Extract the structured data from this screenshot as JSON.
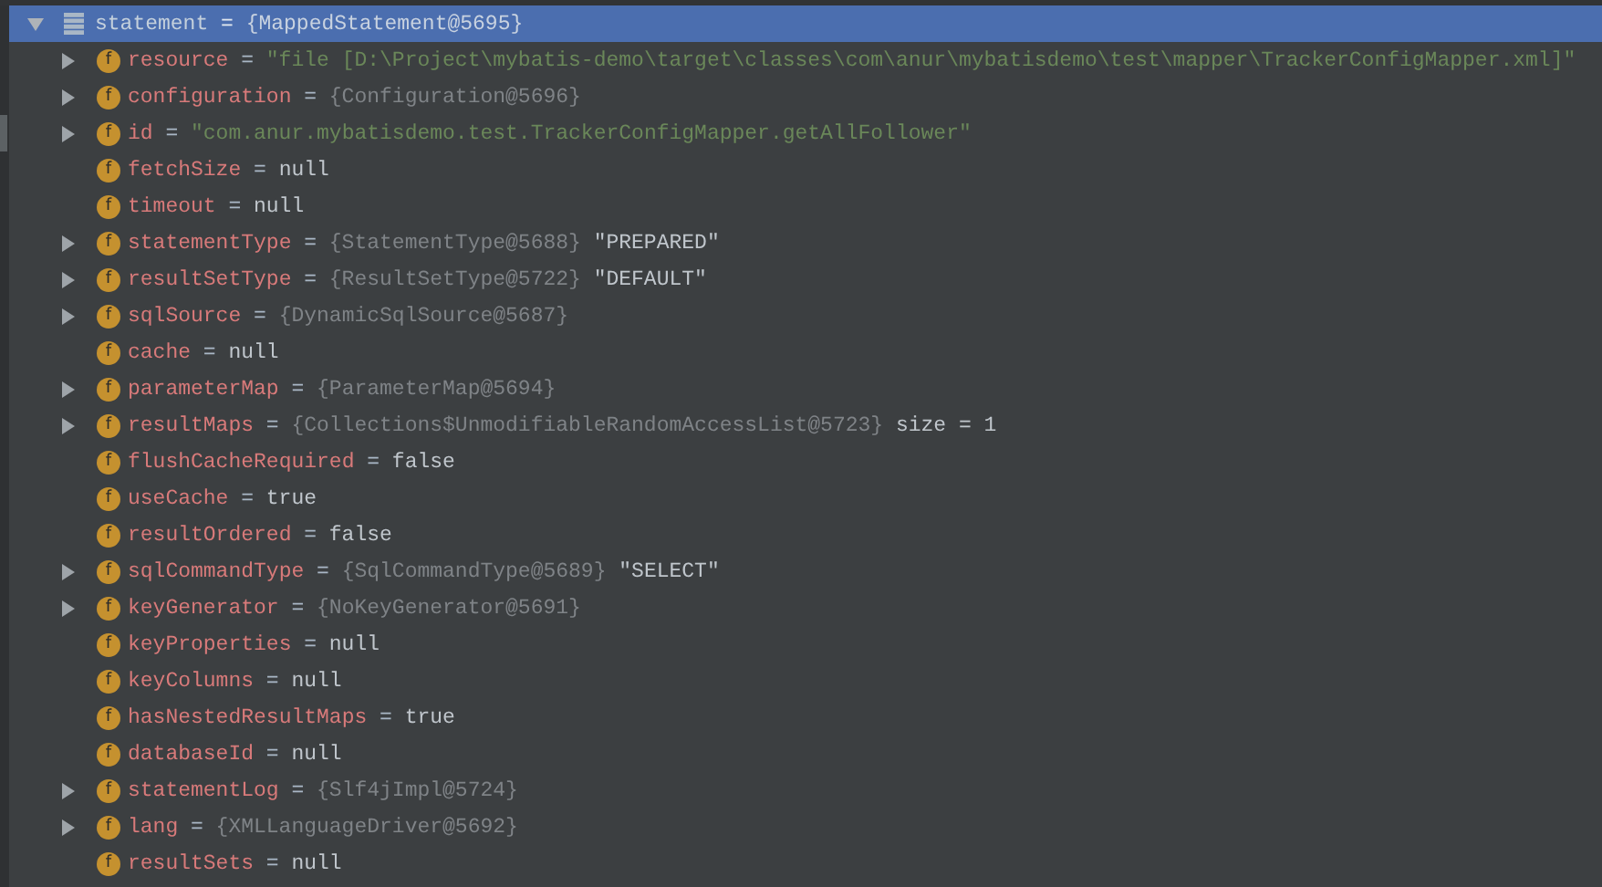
{
  "tree": {
    "name": "statement",
    "sep": "=",
    "value": "{MappedStatement@5695}",
    "kind": "object",
    "expandable": true,
    "expanded": true,
    "selected": true,
    "children": [
      {
        "name": "resource",
        "sep": "=",
        "value": "\"file [D:\\Project\\mybatis-demo\\target\\classes\\com\\anur\\mybatisdemo\\test\\mapper\\TrackerConfigMapper.xml]\"",
        "kind": "string",
        "expandable": true,
        "selected": false,
        "badge": "f"
      },
      {
        "name": "configuration",
        "sep": "=",
        "value": "{Configuration@5696}",
        "kind": "object",
        "expandable": true,
        "selected": false,
        "badge": "f"
      },
      {
        "name": "id",
        "sep": "=",
        "value": "\"com.anur.mybatisdemo.test.TrackerConfigMapper.getAllFollower\"",
        "kind": "string",
        "expandable": true,
        "selected": false,
        "badge": "f"
      },
      {
        "name": "fetchSize",
        "sep": "=",
        "value": "null",
        "kind": "literal",
        "expandable": false,
        "selected": false,
        "badge": "f"
      },
      {
        "name": "timeout",
        "sep": "=",
        "value": "null",
        "kind": "literal",
        "expandable": false,
        "selected": false,
        "badge": "f"
      },
      {
        "name": "statementType",
        "sep": "=",
        "value": "{StatementType@5688}",
        "extra": "\"PREPARED\"",
        "kind": "object",
        "expandable": true,
        "selected": false,
        "badge": "f"
      },
      {
        "name": "resultSetType",
        "sep": "=",
        "value": "{ResultSetType@5722}",
        "extra": "\"DEFAULT\"",
        "kind": "object",
        "expandable": true,
        "selected": false,
        "badge": "f"
      },
      {
        "name": "sqlSource",
        "sep": "=",
        "value": "{DynamicSqlSource@5687}",
        "kind": "object",
        "expandable": true,
        "selected": false,
        "badge": "f"
      },
      {
        "name": "cache",
        "sep": "=",
        "value": "null",
        "kind": "literal",
        "expandable": false,
        "selected": false,
        "badge": "f"
      },
      {
        "name": "parameterMap",
        "sep": "=",
        "value": "{ParameterMap@5694}",
        "kind": "object",
        "expandable": true,
        "selected": false,
        "badge": "f"
      },
      {
        "name": "resultMaps",
        "sep": "=",
        "value": "{Collections$UnmodifiableRandomAccessList@5723}",
        "extra": "size = 1",
        "kind": "object",
        "expandable": true,
        "selected": false,
        "badge": "f"
      },
      {
        "name": "flushCacheRequired",
        "sep": "=",
        "value": "false",
        "kind": "literal",
        "expandable": false,
        "selected": false,
        "badge": "f"
      },
      {
        "name": "useCache",
        "sep": "=",
        "value": "true",
        "kind": "literal",
        "expandable": false,
        "selected": false,
        "badge": "f"
      },
      {
        "name": "resultOrdered",
        "sep": "=",
        "value": "false",
        "kind": "literal",
        "expandable": false,
        "selected": false,
        "badge": "f"
      },
      {
        "name": "sqlCommandType",
        "sep": "=",
        "value": "{SqlCommandType@5689}",
        "extra": "\"SELECT\"",
        "kind": "object",
        "expandable": true,
        "selected": false,
        "badge": "f"
      },
      {
        "name": "keyGenerator",
        "sep": "=",
        "value": "{NoKeyGenerator@5691}",
        "kind": "object",
        "expandable": true,
        "selected": false,
        "badge": "f"
      },
      {
        "name": "keyProperties",
        "sep": "=",
        "value": "null",
        "kind": "literal",
        "expandable": false,
        "selected": false,
        "badge": "f"
      },
      {
        "name": "keyColumns",
        "sep": "=",
        "value": "null",
        "kind": "literal",
        "expandable": false,
        "selected": false,
        "badge": "f"
      },
      {
        "name": "hasNestedResultMaps",
        "sep": "=",
        "value": "true",
        "kind": "literal",
        "expandable": false,
        "selected": false,
        "badge": "f"
      },
      {
        "name": "databaseId",
        "sep": "=",
        "value": "null",
        "kind": "literal",
        "expandable": false,
        "selected": false,
        "badge": "f"
      },
      {
        "name": "statementLog",
        "sep": "=",
        "value": "{Slf4jImpl@5724}",
        "kind": "object",
        "expandable": true,
        "selected": false,
        "badge": "f"
      },
      {
        "name": "lang",
        "sep": "=",
        "value": "{XMLLanguageDriver@5692}",
        "kind": "object",
        "expandable": true,
        "selected": false,
        "badge": "f"
      },
      {
        "name": "resultSets",
        "sep": "=",
        "value": "null",
        "kind": "literal",
        "expandable": false,
        "selected": false,
        "badge": "f"
      }
    ]
  }
}
